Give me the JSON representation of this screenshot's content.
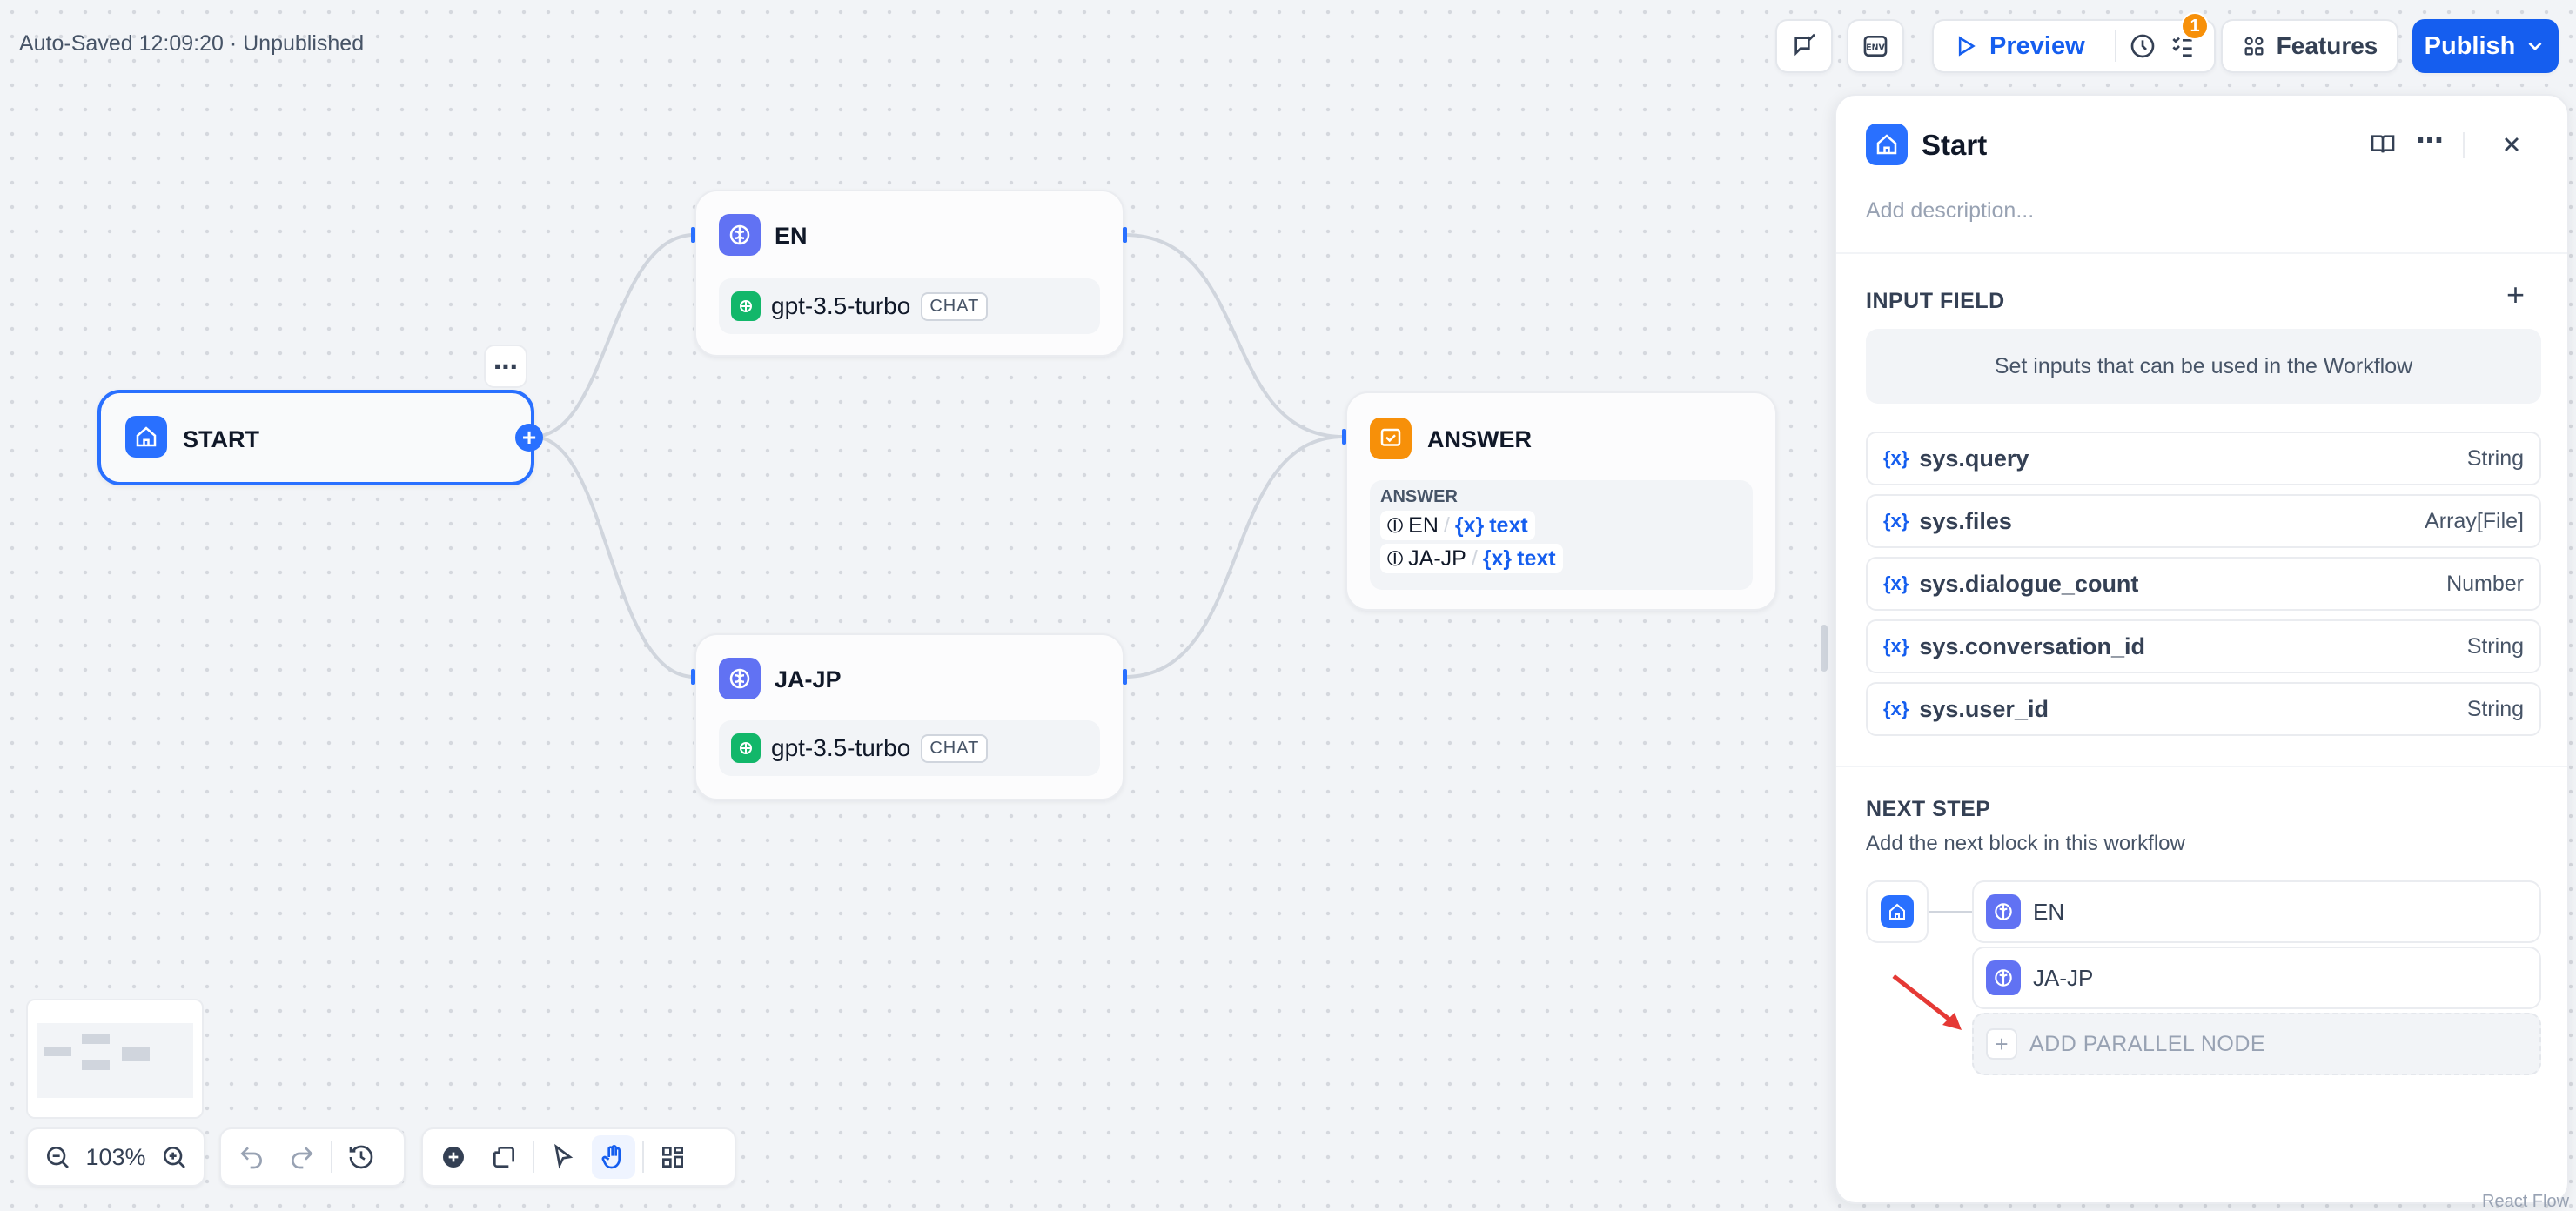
{
  "topbar": {
    "autosave": "Auto-Saved 12:09:20 · Unpublished",
    "preview_label": "Preview",
    "checklist_badge": "1",
    "features_label": "Features",
    "publish_label": "Publish"
  },
  "canvas": {
    "start_node": {
      "title": "START"
    },
    "en_node": {
      "title": "EN",
      "model": "gpt-3.5-turbo",
      "mode": "CHAT"
    },
    "ja_node": {
      "title": "JA-JP",
      "model": "gpt-3.5-turbo",
      "mode": "CHAT"
    },
    "answer_node": {
      "title": "ANSWER",
      "section_label": "ANSWER",
      "refs": [
        {
          "node": "EN",
          "var": "text"
        },
        {
          "node": "JA-JP",
          "var": "text"
        }
      ]
    }
  },
  "panel": {
    "title": "Start",
    "description_placeholder": "Add description...",
    "input_field_title": "INPUT FIELD",
    "input_hint": "Set inputs that can be used in the Workflow",
    "variables": [
      {
        "name": "sys.query",
        "type": "String"
      },
      {
        "name": "sys.files",
        "type": "Array[File]"
      },
      {
        "name": "sys.dialogue_count",
        "type": "Number"
      },
      {
        "name": "sys.conversation_id",
        "type": "String"
      },
      {
        "name": "sys.user_id",
        "type": "String"
      }
    ],
    "next_step_title": "NEXT STEP",
    "next_step_desc": "Add the next block in this workflow",
    "next_nodes": [
      "EN",
      "JA-JP"
    ],
    "add_parallel_label": "ADD PARALLEL NODE"
  },
  "bottom": {
    "zoom": "103%"
  },
  "watermark": "React Flow",
  "colors": {
    "accent": "#155eef",
    "start_icon": "#2970ff",
    "llm_icon": "#6172f3",
    "answer_icon": "#f79009",
    "annotation_arrow": "#e53935"
  }
}
